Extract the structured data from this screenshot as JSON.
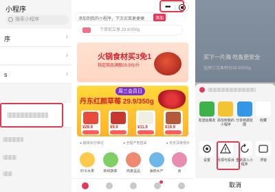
{
  "screen1": {
    "title": "小程序",
    "search_placeholder": "搜索小程序",
    "rows": [
      {
        "label": "序"
      },
      {
        "label": ""
      },
      {
        "label": "s"
      }
    ]
  },
  "screen2": {
    "notice_text": "添加到我的小程序，下次买菜更便捷",
    "notice_button": "添加",
    "location_text": "下单前立享 29.9/350g",
    "banner_title": "火锅食材买3免1",
    "banner_sub": "指定商品满额29.9元/斤",
    "promo_bar": "周三会员日",
    "promo_big": "丹东红颜草莓 29.9/350g",
    "products": [
      {
        "price": "¥29.9"
      },
      {
        "price": "¥9.9"
      },
      {
        "price": "¥11.9"
      },
      {
        "price": "¥19.9"
      }
    ],
    "features": [
      "● 最快30分钟达",
      "● 全程产地直采",
      "● 天天深夜低价"
    ],
    "categories": [
      {
        "label": "时令水果",
        "color": "#ffc94a"
      },
      {
        "label": "新鲜蔬菜",
        "color": "#7fcf65"
      },
      {
        "label": "肉禽蛋品",
        "color": "#ef8a70"
      },
      {
        "label": "海鲜水产",
        "color": "#6cb8e8"
      },
      {
        "label": "食",
        "color": "#e98cb0"
      }
    ]
  },
  "screen3": {
    "banner_text": "买下一片海 吃鱼更安全",
    "banner_sub": "挂牌三文鱼特价39.9/500g",
    "options_row1": [
      {
        "label": "发送给朋友",
        "icon": "share-icon",
        "color": "#3fb14b"
      },
      {
        "label": "添加到我的小程序",
        "icon": "dots-icon",
        "color": "#f3c331"
      },
      {
        "label": "分享到朋友圈",
        "icon": "moments-icon",
        "color": "#3396e6"
      },
      {
        "label": "收藏",
        "icon": "star-icon",
        "color": "#f1f1f1"
      }
    ],
    "options_row2": [
      {
        "label": "设置",
        "icon": "gear-icon",
        "color": "#ffffff"
      },
      {
        "label": "反馈与投诉",
        "icon": "warning-icon",
        "color": "#ffffff"
      },
      {
        "label": "重新进入小程序",
        "icon": "reload-icon",
        "color": "#ffffff"
      },
      {
        "label": "浮窗",
        "icon": "float-window-icon",
        "color": "#ffffff"
      }
    ],
    "cancel": "取消"
  },
  "colors": {
    "accent": "#e6375a",
    "highlight": "#e23a4d"
  }
}
